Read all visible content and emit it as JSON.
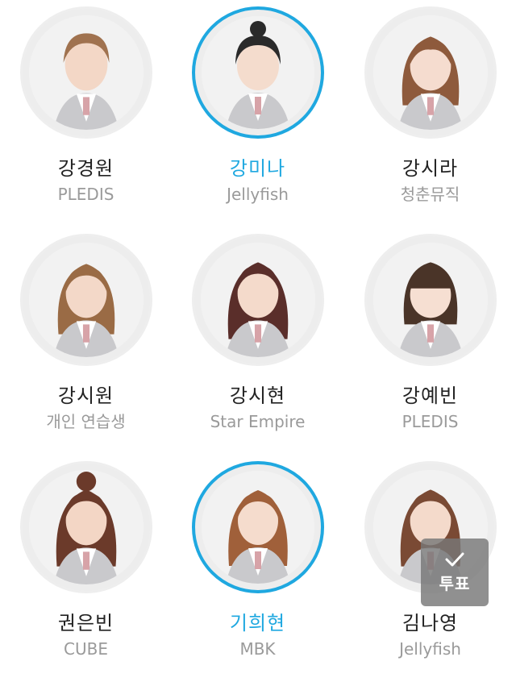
{
  "colors": {
    "accent": "#1fa8e0",
    "name_text": "#222222",
    "agency_text": "#9a9a9a"
  },
  "trainees": [
    {
      "name": "강경원",
      "agency": "PLEDIS",
      "selected": false
    },
    {
      "name": "강미나",
      "agency": "Jellyfish",
      "selected": true
    },
    {
      "name": "강시라",
      "agency": "청춘뮤직",
      "selected": false
    },
    {
      "name": "강시원",
      "agency": "개인 연습생",
      "selected": false
    },
    {
      "name": "강시현",
      "agency": "Star Empire",
      "selected": false
    },
    {
      "name": "강예빈",
      "agency": "PLEDIS",
      "selected": false
    },
    {
      "name": "권은빈",
      "agency": "CUBE",
      "selected": false
    },
    {
      "name": "기희현",
      "agency": "MBK",
      "selected": true
    },
    {
      "name": "김나영",
      "agency": "Jellyfish",
      "selected": false
    }
  ],
  "vote_button": {
    "icon": "checkmark-icon",
    "label": "투표"
  }
}
